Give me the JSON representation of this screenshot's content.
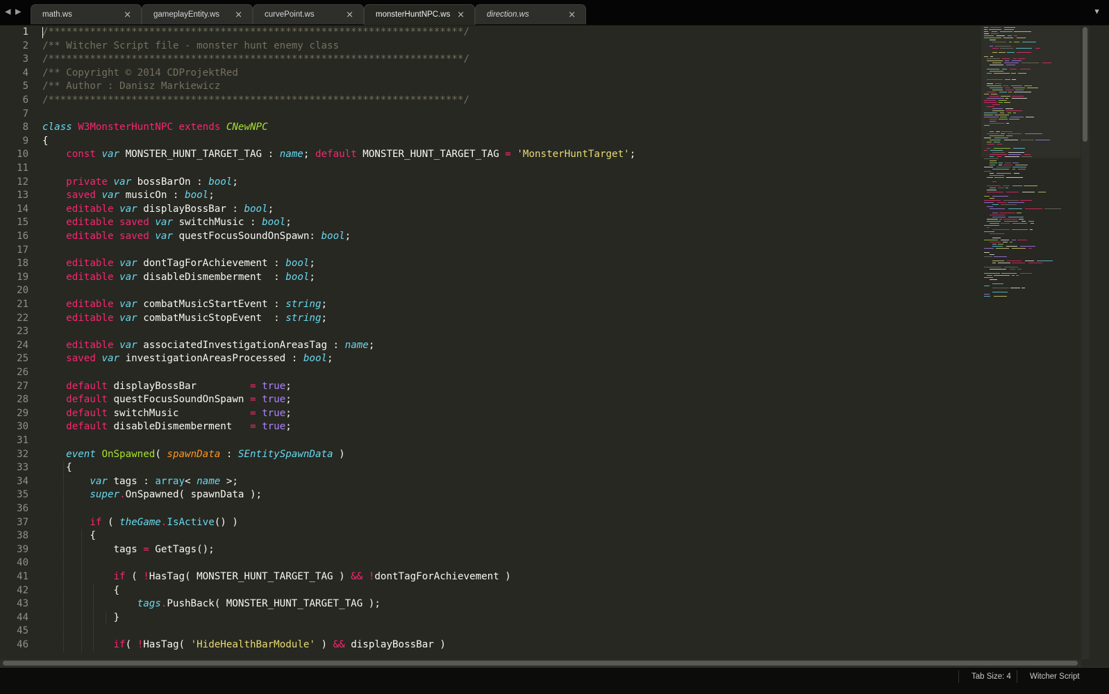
{
  "tabs": [
    {
      "label": "math.ws",
      "active": false,
      "preview": false
    },
    {
      "label": "gameplayEntity.ws",
      "active": false,
      "preview": false
    },
    {
      "label": "curvePoint.ws",
      "active": false,
      "preview": false
    },
    {
      "label": "monsterHuntNPC.ws",
      "active": true,
      "preview": false
    },
    {
      "label": "direction.ws",
      "active": false,
      "preview": true
    }
  ],
  "close_glyph": "×",
  "nav": {
    "back": "◀",
    "forward": "▶",
    "menu": "▼"
  },
  "editor": {
    "current_line": 1,
    "lines": [
      [
        [
          "c",
          "/**********************************************************************/"
        ]
      ],
      [
        [
          "c",
          "/** Witcher Script file - monster hunt enemy class"
        ]
      ],
      [
        [
          "c",
          "/**********************************************************************/"
        ]
      ],
      [
        [
          "c",
          "/** Copyright © 2014 CDProjektRed"
        ]
      ],
      [
        [
          "c",
          "/** Author : Danisz Markiewicz"
        ]
      ],
      [
        [
          "c",
          "/**********************************************************************/"
        ]
      ],
      [],
      [
        [
          "s",
          "class"
        ],
        [
          "t",
          " "
        ],
        [
          "k",
          "W3MonsterHuntNPC"
        ],
        [
          "t",
          " "
        ],
        [
          "k",
          "extends"
        ],
        [
          "t",
          " "
        ],
        [
          "ni",
          "CNewNPC"
        ]
      ],
      [
        [
          "t",
          "{"
        ]
      ],
      [
        [
          "t",
          "    "
        ],
        [
          "k",
          "const"
        ],
        [
          "t",
          " "
        ],
        [
          "s",
          "var"
        ],
        [
          "t",
          " MONSTER_HUNT_TARGET_TAG : "
        ],
        [
          "s",
          "name"
        ],
        [
          "t",
          "; "
        ],
        [
          "k",
          "default"
        ],
        [
          "t",
          " MONSTER_HUNT_TARGET_TAG "
        ],
        [
          "k",
          "="
        ],
        [
          "t",
          " "
        ],
        [
          "str",
          "'MonsterHuntTarget'"
        ],
        [
          "t",
          ";"
        ]
      ],
      [],
      [
        [
          "t",
          "    "
        ],
        [
          "k",
          "private"
        ],
        [
          "t",
          " "
        ],
        [
          "s",
          "var"
        ],
        [
          "t",
          " bossBarOn : "
        ],
        [
          "s",
          "bool"
        ],
        [
          "t",
          ";"
        ]
      ],
      [
        [
          "t",
          "    "
        ],
        [
          "k",
          "saved"
        ],
        [
          "t",
          " "
        ],
        [
          "s",
          "var"
        ],
        [
          "t",
          " musicOn : "
        ],
        [
          "s",
          "bool"
        ],
        [
          "t",
          ";"
        ]
      ],
      [
        [
          "t",
          "    "
        ],
        [
          "k",
          "editable"
        ],
        [
          "t",
          " "
        ],
        [
          "s",
          "var"
        ],
        [
          "t",
          " displayBossBar : "
        ],
        [
          "s",
          "bool"
        ],
        [
          "t",
          ";"
        ]
      ],
      [
        [
          "t",
          "    "
        ],
        [
          "k",
          "editable saved"
        ],
        [
          "t",
          " "
        ],
        [
          "s",
          "var"
        ],
        [
          "t",
          " switchMusic : "
        ],
        [
          "s",
          "bool"
        ],
        [
          "t",
          ";"
        ]
      ],
      [
        [
          "t",
          "    "
        ],
        [
          "k",
          "editable saved"
        ],
        [
          "t",
          " "
        ],
        [
          "s",
          "var"
        ],
        [
          "t",
          " questFocusSoundOnSpawn: "
        ],
        [
          "s",
          "bool"
        ],
        [
          "t",
          ";"
        ]
      ],
      [],
      [
        [
          "t",
          "    "
        ],
        [
          "k",
          "editable"
        ],
        [
          "t",
          " "
        ],
        [
          "s",
          "var"
        ],
        [
          "t",
          " dontTagForAchievement : "
        ],
        [
          "s",
          "bool"
        ],
        [
          "t",
          ";"
        ]
      ],
      [
        [
          "t",
          "    "
        ],
        [
          "k",
          "editable"
        ],
        [
          "t",
          " "
        ],
        [
          "s",
          "var"
        ],
        [
          "t",
          " disableDismemberment  : "
        ],
        [
          "s",
          "bool"
        ],
        [
          "t",
          ";"
        ]
      ],
      [],
      [
        [
          "t",
          "    "
        ],
        [
          "k",
          "editable"
        ],
        [
          "t",
          " "
        ],
        [
          "s",
          "var"
        ],
        [
          "t",
          " combatMusicStartEvent : "
        ],
        [
          "s",
          "string"
        ],
        [
          "t",
          ";"
        ]
      ],
      [
        [
          "t",
          "    "
        ],
        [
          "k",
          "editable"
        ],
        [
          "t",
          " "
        ],
        [
          "s",
          "var"
        ],
        [
          "t",
          " combatMusicStopEvent  : "
        ],
        [
          "s",
          "string"
        ],
        [
          "t",
          ";"
        ]
      ],
      [],
      [
        [
          "t",
          "    "
        ],
        [
          "k",
          "editable"
        ],
        [
          "t",
          " "
        ],
        [
          "s",
          "var"
        ],
        [
          "t",
          " associatedInvestigationAreasTag : "
        ],
        [
          "s",
          "name"
        ],
        [
          "t",
          ";"
        ]
      ],
      [
        [
          "t",
          "    "
        ],
        [
          "k",
          "saved"
        ],
        [
          "t",
          " "
        ],
        [
          "s",
          "var"
        ],
        [
          "t",
          " investigationAreasProcessed : "
        ],
        [
          "s",
          "bool"
        ],
        [
          "t",
          ";"
        ]
      ],
      [],
      [
        [
          "t",
          "    "
        ],
        [
          "k",
          "default"
        ],
        [
          "t",
          " displayBossBar         "
        ],
        [
          "k",
          "="
        ],
        [
          "t",
          " "
        ],
        [
          "num",
          "true"
        ],
        [
          "t",
          ";"
        ]
      ],
      [
        [
          "t",
          "    "
        ],
        [
          "k",
          "default"
        ],
        [
          "t",
          " questFocusSoundOnSpawn "
        ],
        [
          "k",
          "="
        ],
        [
          "t",
          " "
        ],
        [
          "num",
          "true"
        ],
        [
          "t",
          ";"
        ]
      ],
      [
        [
          "t",
          "    "
        ],
        [
          "k",
          "default"
        ],
        [
          "t",
          " switchMusic            "
        ],
        [
          "k",
          "="
        ],
        [
          "t",
          " "
        ],
        [
          "num",
          "true"
        ],
        [
          "t",
          ";"
        ]
      ],
      [
        [
          "t",
          "    "
        ],
        [
          "k",
          "default"
        ],
        [
          "t",
          " disableDismemberment   "
        ],
        [
          "k",
          "="
        ],
        [
          "t",
          " "
        ],
        [
          "num",
          "true"
        ],
        [
          "t",
          ";"
        ]
      ],
      [],
      [
        [
          "t",
          "    "
        ],
        [
          "s",
          "event"
        ],
        [
          "t",
          " "
        ],
        [
          "n",
          "OnSpawned"
        ],
        [
          "t",
          "( "
        ],
        [
          "p",
          "spawnData"
        ],
        [
          "t",
          " : "
        ],
        [
          "obj",
          "SEntitySpawnData"
        ],
        [
          "t",
          " )"
        ]
      ],
      [
        [
          "t",
          "    {"
        ]
      ],
      [
        [
          "t",
          "        "
        ],
        [
          "s",
          "var"
        ],
        [
          "t",
          " tags : "
        ],
        [
          "fn",
          "array"
        ],
        [
          "t",
          "< "
        ],
        [
          "s",
          "name"
        ],
        [
          "t",
          " >;"
        ]
      ],
      [
        [
          "t",
          "        "
        ],
        [
          "obj",
          "super"
        ],
        [
          "k",
          "."
        ],
        [
          "t",
          "OnSpawned( spawnData );"
        ]
      ],
      [],
      [
        [
          "t",
          "        "
        ],
        [
          "k",
          "if"
        ],
        [
          "t",
          " ( "
        ],
        [
          "obj",
          "theGame"
        ],
        [
          "k",
          "."
        ],
        [
          "fn",
          "IsActive"
        ],
        [
          "t",
          "() )"
        ]
      ],
      [
        [
          "t",
          "        {"
        ]
      ],
      [
        [
          "t",
          "            tags "
        ],
        [
          "k",
          "="
        ],
        [
          "t",
          " GetTags();"
        ]
      ],
      [],
      [
        [
          "t",
          "            "
        ],
        [
          "k",
          "if"
        ],
        [
          "t",
          " ( "
        ],
        [
          "k",
          "!"
        ],
        [
          "t",
          "HasTag( MONSTER_HUNT_TARGET_TAG ) "
        ],
        [
          "k",
          "&&"
        ],
        [
          "t",
          " "
        ],
        [
          "k",
          "!"
        ],
        [
          "t",
          "dontTagForAchievement )"
        ]
      ],
      [
        [
          "t",
          "            {"
        ]
      ],
      [
        [
          "t",
          "                "
        ],
        [
          "obj",
          "tags"
        ],
        [
          "k",
          "."
        ],
        [
          "t",
          "PushBack( MONSTER_HUNT_TARGET_TAG );"
        ]
      ],
      [
        [
          "t",
          "            }"
        ]
      ],
      [],
      [
        [
          "t",
          "            "
        ],
        [
          "k",
          "if"
        ],
        [
          "t",
          "( "
        ],
        [
          "k",
          "!"
        ],
        [
          "t",
          "HasTag( "
        ],
        [
          "str",
          "'HideHealthBarModule'"
        ],
        [
          "t",
          " ) "
        ],
        [
          "k",
          "&&"
        ],
        [
          "t",
          " displayBossBar )"
        ]
      ]
    ]
  },
  "status": {
    "tab_size": "Tab Size: 4",
    "syntax": "Witcher Script"
  }
}
